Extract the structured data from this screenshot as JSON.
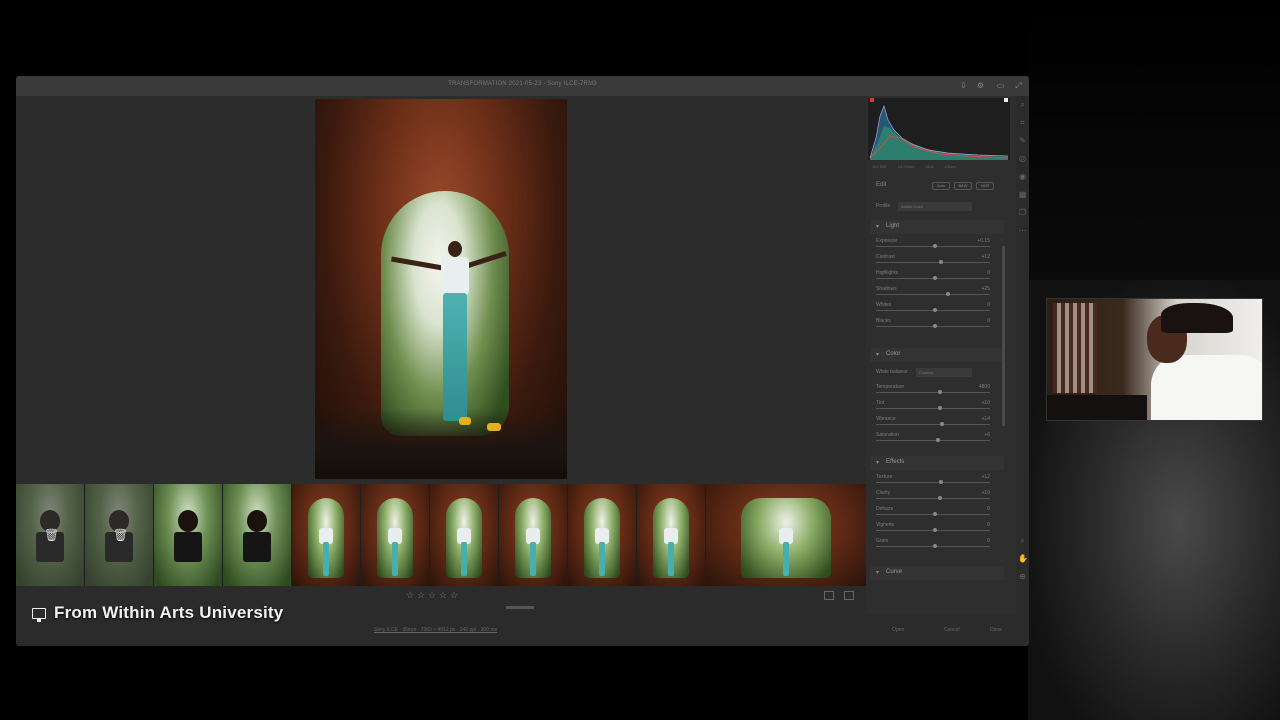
{
  "window": {
    "title": "TRANSFORMATION 2021-05-23 · Sony ILCE-7RM3"
  },
  "main_photo": {
    "alt_semantic": "woman-in-cave-arch-photo"
  },
  "filmstrip": {
    "thumbnails": [
      {
        "kind": "trashed",
        "semantic": "adidas-shirt-thumb"
      },
      {
        "kind": "trashed",
        "semantic": "adidas-shirt-thumb"
      },
      {
        "kind": "normal",
        "semantic": "adidas-shirt-thumb"
      },
      {
        "kind": "normal",
        "semantic": "adidas-shirt-thumb"
      },
      {
        "kind": "normal",
        "semantic": "cave-arch-thumb"
      },
      {
        "kind": "selected",
        "semantic": "cave-arch-thumb"
      },
      {
        "kind": "normal",
        "semantic": "cave-arch-thumb"
      },
      {
        "kind": "normal",
        "semantic": "cave-arch-thumb"
      },
      {
        "kind": "normal",
        "semantic": "cave-arch-thumb"
      },
      {
        "kind": "normal",
        "semantic": "cave-arch-thumb"
      },
      {
        "kind": "normal",
        "semantic": "cave-arch-wide-thumb"
      }
    ],
    "rating_stars": 5
  },
  "status": {
    "info": "Sony ILCE · 35mm · 7360 × 4912 px · 240 ppi · 300 ms",
    "open_label": "Open",
    "cancel_label": "Cancel",
    "done_label": "Done"
  },
  "panel": {
    "histogram_meta": [
      "100 200",
      "24-70mm",
      "f/2.8",
      "1/5sec"
    ],
    "edit_label": "Edit",
    "edit_buttons": [
      "Auto",
      "B&W",
      "HDR"
    ],
    "profile_label": "Profile",
    "profile_value": "Adobe Color",
    "sections": {
      "light": "Light",
      "color": "Color",
      "effects": "Effects",
      "curve": "Curve"
    },
    "light_rows": [
      {
        "label": "Exposure",
        "value": "+0.15"
      },
      {
        "label": "Contrast",
        "value": "+12"
      },
      {
        "label": "Highlights",
        "value": "0"
      },
      {
        "label": "Shadows",
        "value": "+25"
      },
      {
        "label": "Whites",
        "value": "0"
      },
      {
        "label": "Blacks",
        "value": "0"
      }
    ],
    "wb_label": "White balance",
    "wb_value": "Custom",
    "color_rows": [
      {
        "label": "Temperature",
        "value": "4800"
      },
      {
        "label": "Tint",
        "value": "+10"
      },
      {
        "label": "Vibrance",
        "value": "+14"
      },
      {
        "label": "Saturation",
        "value": "+6"
      }
    ],
    "effects_rows": [
      {
        "label": "Texture",
        "value": "+12"
      },
      {
        "label": "Clarity",
        "value": "+10"
      },
      {
        "label": "Dehaze",
        "value": "0"
      },
      {
        "label": "Vignette",
        "value": "0"
      },
      {
        "label": "Grain",
        "value": "0"
      }
    ]
  },
  "caption": {
    "text": "From Within Arts University"
  },
  "colors": {
    "window_bg": "#2b2b2b",
    "panel_bg": "#2e2e2e",
    "selected_outline": "#f0f0f0",
    "teal": "#49aeae"
  }
}
